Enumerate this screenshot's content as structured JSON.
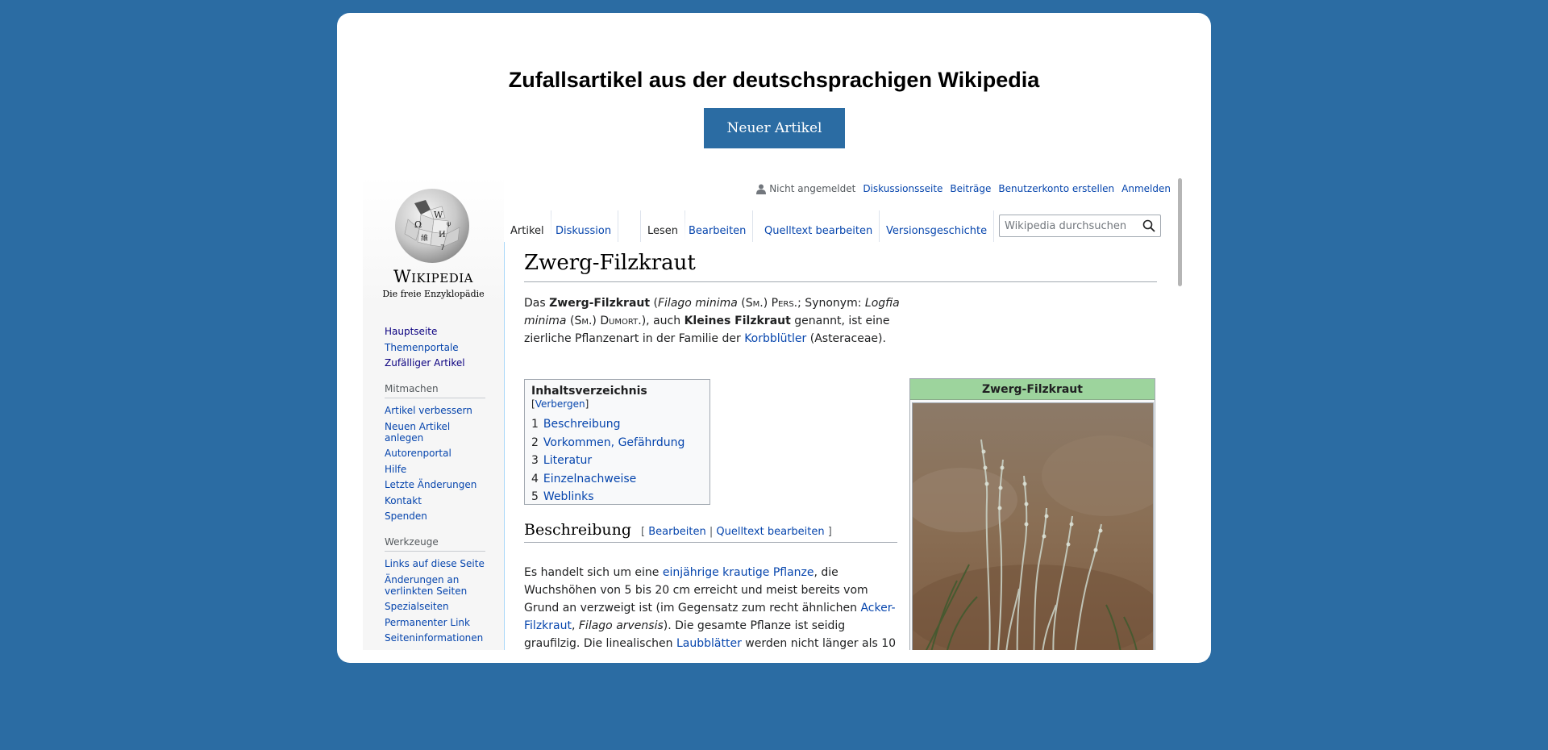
{
  "page": {
    "title": "Zufallsartikel aus der deutschsprachigen Wikipedia",
    "new_article_button": "Neuer Artikel"
  },
  "wiki": {
    "logo_wordmark": "Wikipedia",
    "logo_tagline": "Die freie Enzyklopädie",
    "nav_main": [
      "Hauptseite",
      "Themenportale",
      "Zufälliger Artikel"
    ],
    "mitmachen_heading": "Mitmachen",
    "nav_mitmachen": [
      "Artikel verbessern",
      "Neuen Artikel anlegen",
      "Autorenportal",
      "Hilfe",
      "Letzte Änderungen",
      "Kontakt",
      "Spenden"
    ],
    "werkzeuge_heading": "Werkzeuge",
    "nav_werkzeuge": [
      "Links auf diese Seite",
      "Änderungen an verlinkten Seiten",
      "Spezialseiten",
      "Permanenter Link",
      "Seiteninformationen"
    ],
    "personal": {
      "status": "Nicht angemeldet",
      "links": [
        "Diskussionsseite",
        "Beiträge",
        "Benutzerkonto erstellen",
        "Anmelden"
      ]
    },
    "tabs": {
      "artikel": "Artikel",
      "diskussion": "Diskussion",
      "lesen": "Lesen",
      "bearbeiten": "Bearbeiten",
      "quelltext": "Quelltext bearbeiten",
      "versionen": "Versionsgeschichte"
    },
    "search_placeholder": "Wikipedia durchsuchen",
    "article": {
      "title": "Zwerg-Filzkraut",
      "intro": {
        "t1": "Das ",
        "b1": "Zwerg-Filzkraut",
        "t2": " (",
        "i1": "Filago minima",
        "t3": " (",
        "sc1": "Sm.",
        "t4": ") ",
        "sc2": "Pers.",
        "t5": "; Synonym: ",
        "i2": "Logfia minima",
        "t6": " (",
        "sc3": "Sm.",
        "t7": ") ",
        "sc4": "Dumort.",
        "t8": "), auch ",
        "b2": "Kleines Filzkraut",
        "t9": " genannt, ist eine zierliche Pflanzenart in der Familie der ",
        "link1": "Korbblütler",
        "t10": " (Asteraceae)."
      },
      "toc": {
        "title": "Inhaltsverzeichnis",
        "toggle": "Verbergen",
        "items": [
          {
            "num": "1",
            "label": "Beschreibung"
          },
          {
            "num": "2",
            "label": "Vorkommen, Gefährdung"
          },
          {
            "num": "3",
            "label": "Literatur"
          },
          {
            "num": "4",
            "label": "Einzelnachweise"
          },
          {
            "num": "5",
            "label": "Weblinks"
          }
        ]
      },
      "section1": {
        "heading": "Beschreibung",
        "edit1": "Bearbeiten",
        "edit2": "Quelltext bearbeiten"
      },
      "para2": {
        "t1": "Es handelt sich um eine ",
        "link1": "einjährige krautige Pflanze",
        "t2": ", die Wuchshöhen von 5 bis 20 cm erreicht und meist bereits vom Grund an verzweigt ist (im Gegensatz zum recht ähnlichen ",
        "link2": "Acker-Filzkraut",
        "t3": ", ",
        "i1": "Filago arvensis",
        "t4": "). Die gesamte Pflanze ist seidig graufilzig. Die linealischen ",
        "link3": "Laubblätter",
        "t5": " werden nicht länger als 10"
      },
      "infobox_title": "Zwerg-Filzkraut"
    }
  }
}
